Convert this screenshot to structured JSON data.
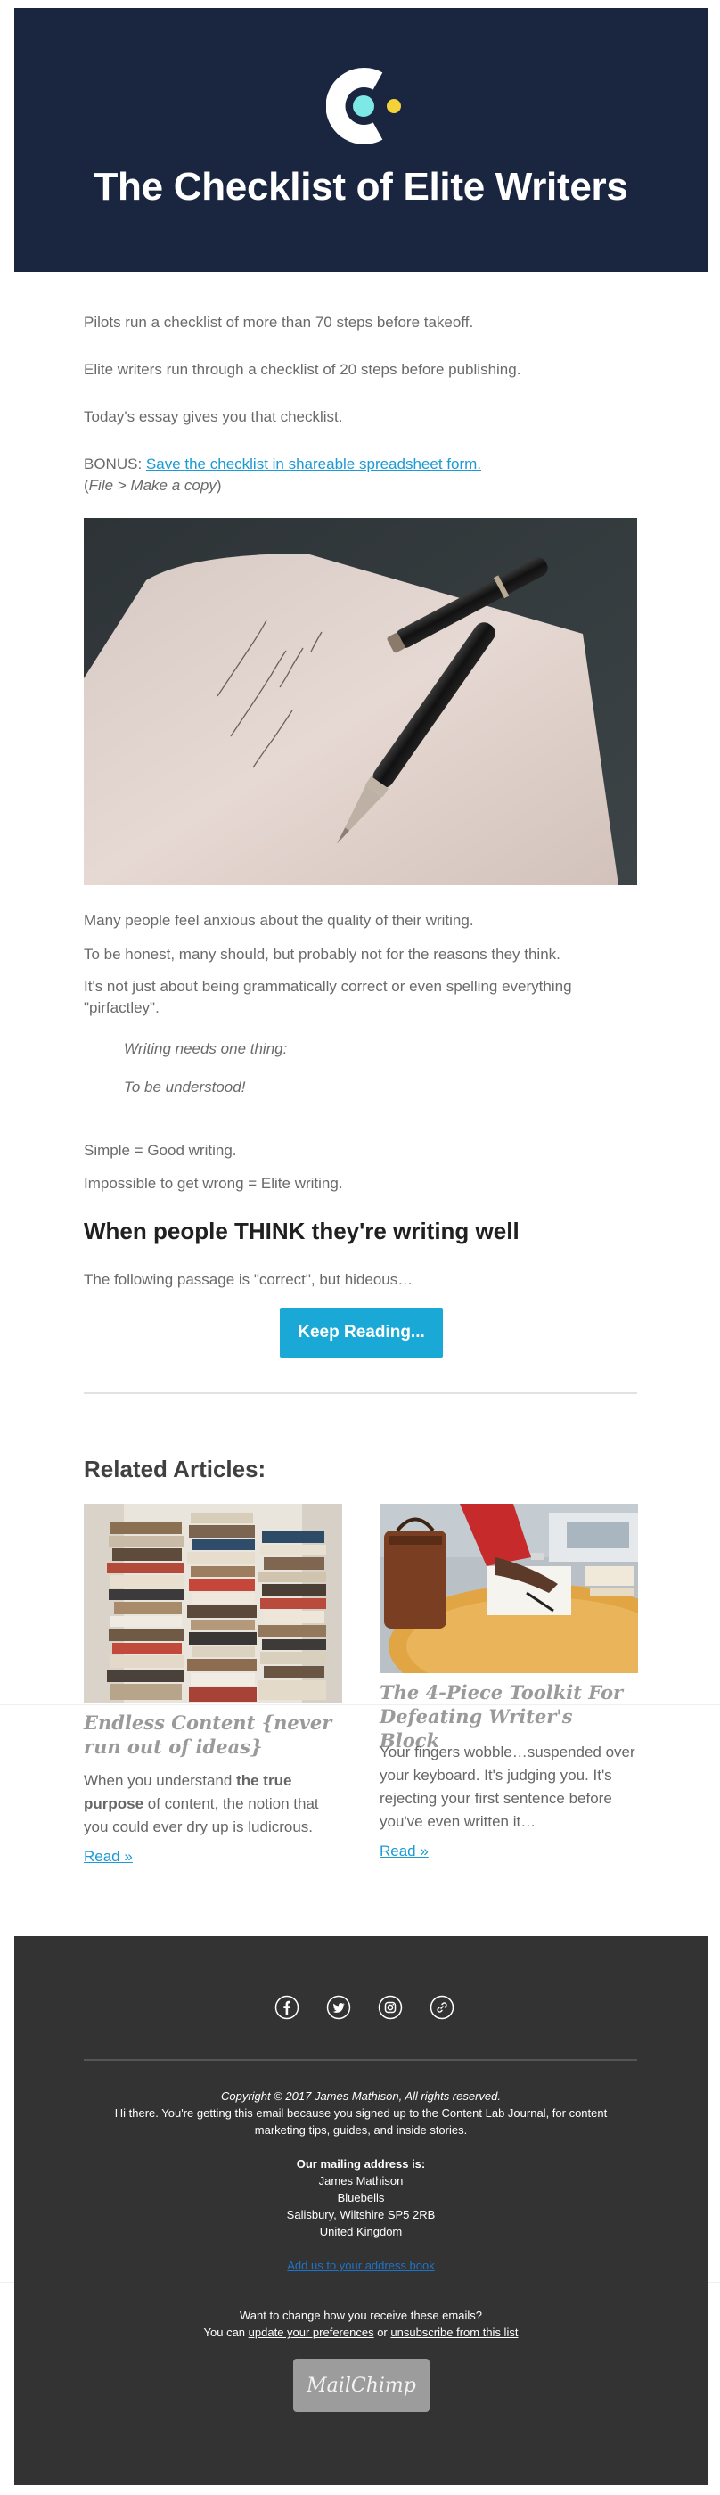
{
  "header": {
    "title": "The Checklist of Elite Writers"
  },
  "intro": {
    "p1": "Pilots run a checklist of more than 70 steps before takeoff.",
    "p2": "Elite writers run through a checklist of 20 steps before publishing.",
    "p3": "Today's essay gives you that checklist.",
    "bonus_prefix": "BONUS: ",
    "bonus_link": "Save the checklist in shareable spreadsheet form.",
    "note_open": "(",
    "note_italic": "File > Make a copy",
    "note_close": ")"
  },
  "body": {
    "p1": "Many people feel anxious about the quality of their writing.",
    "p2": "To be honest, many should, but probably not for the reasons they think.",
    "p3": "It's not just about being grammatically correct or even spelling everything \"pirfactley\".",
    "q1": "Writing needs one thing:",
    "q2": "To be understood!",
    "p4": "Simple = Good writing.",
    "p5": "Impossible to get wrong = Elite writing.",
    "heading": "When people THINK they're writing well",
    "p6": "The following passage is \"correct\", but hideous…",
    "cta": "Keep Reading..."
  },
  "related": {
    "title": "Related Articles:",
    "articles": [
      {
        "title": "Endless Content {never run out of ideas}",
        "desc_pre": "When you understand ",
        "desc_bold": "the true purpose",
        "desc_post": " of content, the notion that you could ever dry up is ludicrous.",
        "read": "Read »"
      },
      {
        "title": "The 4-Piece Toolkit For Defeating Writer's Block",
        "desc": "Your fingers wobble…suspended over your keyboard. It's judging you. It's rejecting your first sentence before you've even written it…",
        "read": "Read »"
      }
    ]
  },
  "footer": {
    "social_icons": [
      "facebook-icon",
      "twitter-icon",
      "instagram-icon",
      "website-link-icon"
    ],
    "copyright": "Copyright © 2017 James Mathison, All rights reserved.",
    "reason": "Hi there. You're getting this email because you signed up to the Content Lab Journal, for content marketing tips, guides, and inside stories.",
    "mailing_label": "Our mailing address is:",
    "address": [
      "James Mathison",
      "Bluebells",
      "Salisbury, Wiltshire SP5 2RB",
      "United Kingdom"
    ],
    "address_book": "Add us to your address book",
    "change_q": "Want to change how you receive these emails?",
    "change_pre": "You can ",
    "update_link": "update your preferences",
    "change_mid": " or ",
    "unsubscribe_link": "unsubscribe from this list",
    "badge": "MailChimp"
  },
  "colors": {
    "header_bg": "#1a2540",
    "logo_accent_teal": "#7ee8e6",
    "logo_accent_yellow": "#f3d23a",
    "link": "#1b9ad6",
    "cta_bg": "#1aa8d6",
    "footer_bg": "#333333"
  }
}
